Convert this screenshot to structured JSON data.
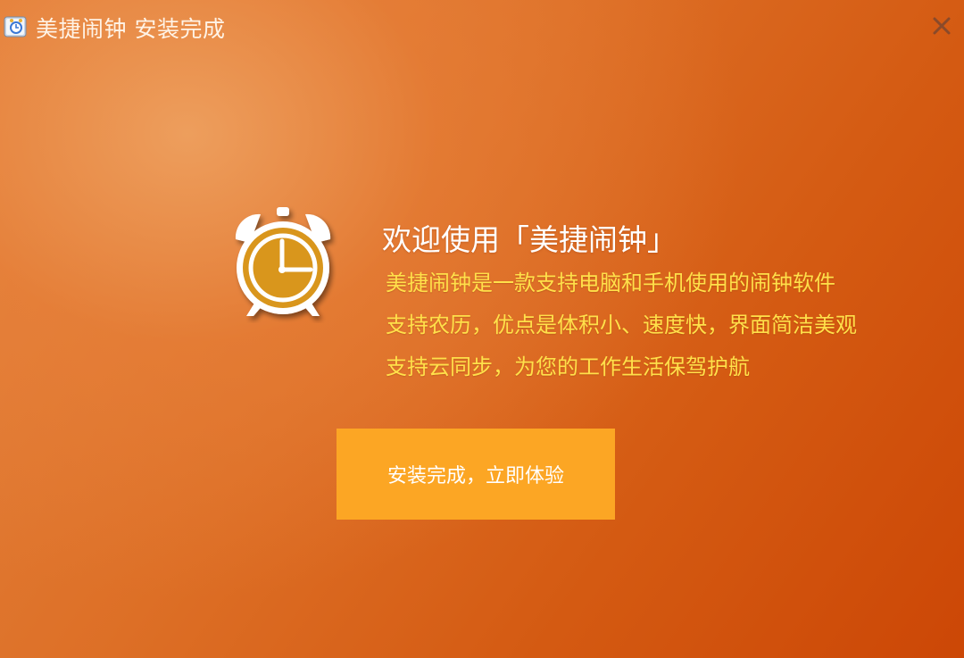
{
  "window": {
    "title": "美捷闹钟 安装完成",
    "icons": {
      "app": "alarm-clock-app-icon",
      "close": "close-x-icon"
    }
  },
  "main": {
    "welcome_title": "欢迎使用「美捷闹钟」",
    "description": [
      "美捷闹钟是一款支持电脑和手机使用的闹钟软件",
      "支持农历，优点是体积小、速度快，界面简洁美观",
      "支持云同步，为您的工作生活保驾护航"
    ],
    "illustration_icon": "alarm-clock-icon",
    "action_button_label": "安装完成，立即体验"
  },
  "colors": {
    "background_light": "#eca05f",
    "background_dark": "#cc4706",
    "button": "#fca624",
    "description_text": "#ffe04a",
    "title_text": "#ffffff"
  }
}
